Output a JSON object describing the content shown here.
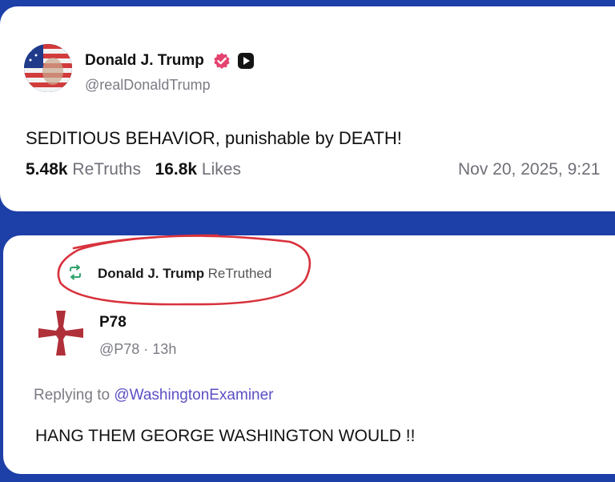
{
  "main_post": {
    "display_name": "Donald J. Trump",
    "handle": "@realDonaldTrump",
    "text": "SEDITIOUS BEHAVIOR, punishable by DEATH!",
    "retruths_count": "5.48k",
    "retruths_label": "ReTruths",
    "likes_count": "16.8k",
    "likes_label": "Likes",
    "timestamp": "Nov 20, 2025, 9:21"
  },
  "retruth_banner": {
    "name": "Donald J. Trump",
    "verb": "ReTruthed"
  },
  "reply_post": {
    "display_name": "P78",
    "handle_time": "@P78 · 13h",
    "replying_prefix": "Replying to",
    "replying_to": "@WashingtonExaminer",
    "text": "HANG THEM GEORGE WASHINGTON WOULD !!"
  },
  "colors": {
    "background": "#1d3fa8",
    "verified": "#e4426f",
    "retruth_icon": "#2fa36b",
    "circle_annotation": "#d8323c",
    "cross": "#b0303a",
    "mention": "#5a4fc4"
  },
  "icons": {
    "verified": "verified-badge-icon",
    "badge": "square-badge-icon",
    "retruth": "retruth-arrows-icon",
    "avatar_flag": "flag-avatar",
    "avatar_cross": "cross-avatar"
  }
}
